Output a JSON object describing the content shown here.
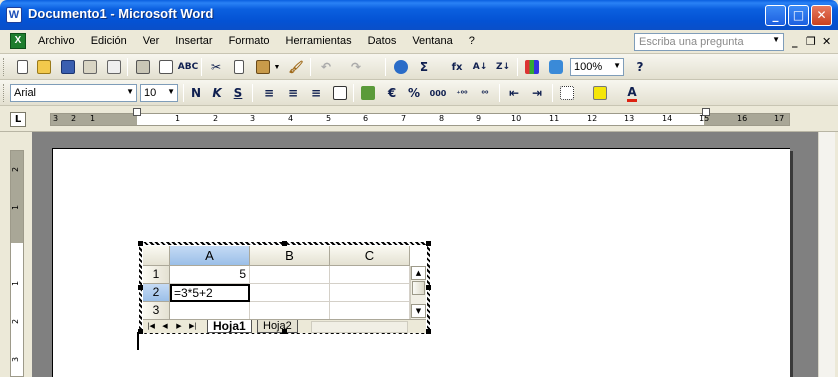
{
  "window": {
    "title": "Documento1 - Microsoft Word",
    "app_icon": "W",
    "controls": {
      "minimize": "_",
      "maximize": "□",
      "close": "✕"
    }
  },
  "menubar": {
    "items": [
      "Archivo",
      "Edición",
      "Ver",
      "Insertar",
      "Formato",
      "Herramientas",
      "Datos",
      "Ventana",
      "?"
    ],
    "help_placeholder": "Escriba una pregunta",
    "doc_icon": "X"
  },
  "toolbar_standard": {
    "zoom": "100%"
  },
  "toolbar_format": {
    "font": "Arial",
    "size": "10",
    "bold": "N",
    "italic": "K",
    "underline": "S",
    "euro": "€",
    "percent": "%",
    "thousands": "000",
    "inc_decimal": "⁺⁰⁰",
    "dec_decimal": "⁰⁰"
  },
  "ruler": {
    "corner": "L",
    "h_labels": [
      "3",
      "2",
      "1",
      "1",
      "2",
      "3",
      "4",
      "5",
      "6",
      "7",
      "8",
      "9",
      "10",
      "11",
      "12",
      "13",
      "14",
      "15",
      "16",
      "17"
    ],
    "v_labels": [
      "2",
      "1",
      "1",
      "2",
      "3"
    ]
  },
  "spreadsheet": {
    "columns": [
      "A",
      "B",
      "C"
    ],
    "rows": [
      {
        "num": "1",
        "cells": [
          "5",
          "",
          ""
        ]
      },
      {
        "num": "2",
        "cells": [
          "=3*5+2",
          "",
          ""
        ]
      },
      {
        "num": "3",
        "cells": [
          "",
          "",
          ""
        ]
      }
    ],
    "tabs": [
      "Hoja1",
      "Hoja2"
    ],
    "active_cell": "A2",
    "tab_nav": [
      "|◀",
      "◀",
      "▶",
      "▶|"
    ]
  },
  "colors": {
    "titlebar": "#0a4fc8",
    "page_bg": "#ffffff",
    "workspace": "#808080",
    "active_header": "#9bbfe8"
  }
}
